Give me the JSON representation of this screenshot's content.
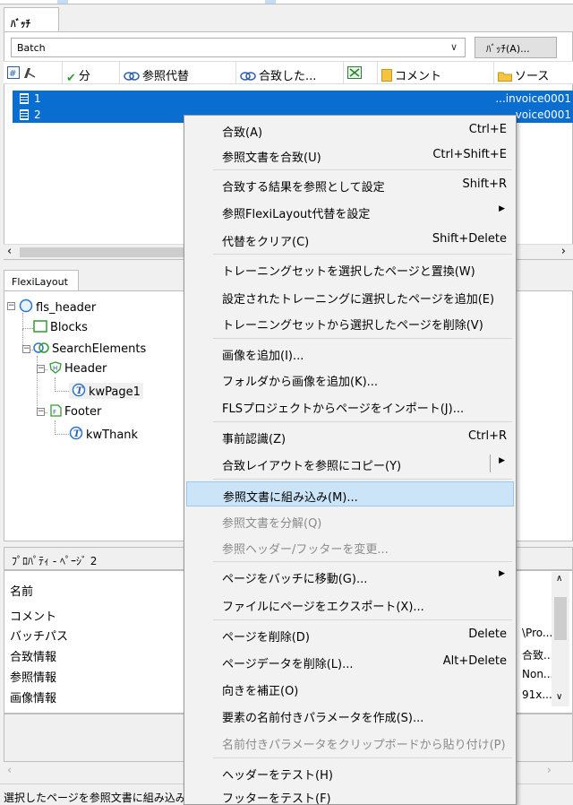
{
  "batch_tab": "ﾊﾞｯﾁ",
  "combo": {
    "value": "Batch"
  },
  "batch_button": "ﾊﾞｯﾁ(A)...",
  "columns": [
    "",
    "分",
    "参照代替",
    "合致した...",
    "",
    "コメント",
    "ソース"
  ],
  "rows": [
    {
      "num": "1",
      "source": "...invoice0001"
    },
    {
      "num": "2",
      "source": "voice0001"
    }
  ],
  "flexi_tab": "FlexiLayout",
  "tree": {
    "root": "fls_header",
    "blocks": "Blocks",
    "search_elements": "SearchElements",
    "header": "Header",
    "kw_page": "kwPage1",
    "footer": "Footer",
    "kw_thank": "kwThank"
  },
  "properties": {
    "title": "ﾌﾟﾛﾊﾟﾃｨ - ﾍﾟｰｼﾞ 2",
    "name_header": "名前",
    "items": [
      "コメント",
      "バッチパス",
      "合致情報",
      "参照情報",
      "画像情報"
    ],
    "values_right": [
      "",
      "",
      "\\Pro...",
      "合致...",
      "Non...",
      "91x..."
    ]
  },
  "status_text": "選択したページを参照文書に組み込み",
  "menu": {
    "items": [
      {
        "label": "合致(A)",
        "shortcut": "Ctrl+E"
      },
      {
        "label": "参照文書を合致(U)",
        "shortcut": "Ctrl+Shift+E"
      },
      {
        "label": "合致する結果を参照として設定",
        "shortcut": "Shift+R"
      },
      {
        "label": "参照FlexiLayout代替を設定",
        "shortcut": ""
      },
      {
        "label": "代替をクリア(C)",
        "shortcut": "Shift+Delete"
      },
      {
        "label": "トレーニングセットを選択したページと置換(W)",
        "shortcut": ""
      },
      {
        "label": "設定されたトレーニングに選択したページを追加(E)",
        "shortcut": ""
      },
      {
        "label": "トレーニングセットから選択したページを削除(V)",
        "shortcut": ""
      },
      {
        "label": "画像を追加(I)...",
        "shortcut": ""
      },
      {
        "label": "フォルダから画像を追加(K)...",
        "shortcut": ""
      },
      {
        "label": "FLSプロジェクトからページをインポート(J)...",
        "shortcut": ""
      },
      {
        "label": "事前認識(Z)",
        "shortcut": "Ctrl+R"
      },
      {
        "label": "合致レイアウトを参照にコピー(Y)",
        "shortcut": ""
      },
      {
        "label": "参照文書に組み込み(M)...",
        "shortcut": ""
      },
      {
        "label": "参照文書を分解(Q)",
        "shortcut": ""
      },
      {
        "label": "参照ヘッダー/フッターを変更...",
        "shortcut": ""
      },
      {
        "label": "ページをバッチに移動(G)...",
        "shortcut": ""
      },
      {
        "label": "ファイルにページをエクスポート(X)...",
        "shortcut": ""
      },
      {
        "label": "ページを削除(D)",
        "shortcut": "Delete"
      },
      {
        "label": "ページデータを削除(L)...",
        "shortcut": "Alt+Delete"
      },
      {
        "label": "向きを補正(O)",
        "shortcut": ""
      },
      {
        "label": "要素の名前付きパラメータを作成(S)...",
        "shortcut": ""
      },
      {
        "label": "名前付きパラメータをクリップボードから貼り付け(P)",
        "shortcut": ""
      },
      {
        "label": "ヘッダーをテスト(H)",
        "shortcut": ""
      },
      {
        "label": "フッターをテスト(F)",
        "shortcut": ""
      }
    ]
  },
  "colors": {
    "selection": "#0a6ed1",
    "menu_highlight": "#cce4f7"
  }
}
